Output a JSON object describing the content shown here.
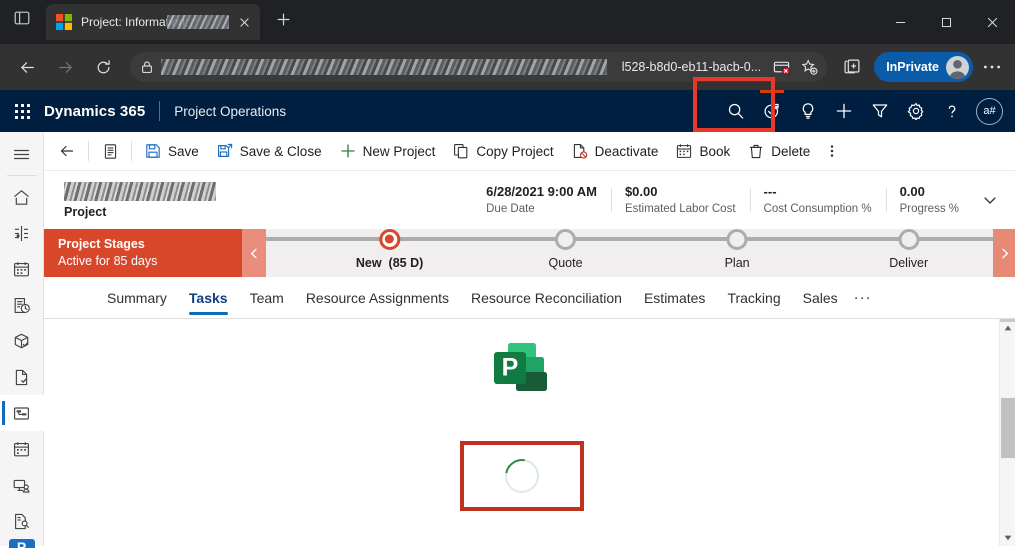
{
  "browser": {
    "tab": {
      "title_prefix": "Project: Information: ",
      "title_suffix": "e b",
      "favicon": "microsoft-logo-icon",
      "close_icon": "close-icon"
    },
    "new_tab_label": "+",
    "window_controls": {
      "minimize": "minimize-icon",
      "maximize": "maximize-icon",
      "close": "close-icon"
    },
    "nav": {
      "back": "back-arrow-icon",
      "forward": "forward-arrow-icon",
      "refresh": "refresh-icon"
    },
    "address_bar": {
      "lock_icon": "lock-icon",
      "url_visible": "l528-b8d0-eb11-bacb-0...",
      "popup_blocked_icon": "popup-blocked-icon",
      "favorite_icon": "add-favorite-star-icon"
    },
    "collections_icon": "collections-icon",
    "profile": {
      "label": "InPrivate",
      "avatar_icon": "person-avatar-icon"
    },
    "settings_icon": "more-settings-icon",
    "annotation_color": "#e8382a"
  },
  "d365_header": {
    "waffle_icon": "app-launcher-waffle-icon",
    "brand": "Dynamics 365",
    "app_name": "Project Operations",
    "icons": [
      {
        "name": "search-icon",
        "highlighted": false
      },
      {
        "name": "trial-status-icon",
        "highlighted": true
      },
      {
        "name": "lightbulb-idea-icon",
        "highlighted": false
      },
      {
        "name": "quick-create-plus-icon",
        "highlighted": false
      },
      {
        "name": "filter-funnel-icon",
        "highlighted": false
      },
      {
        "name": "settings-gear-icon",
        "highlighted": false
      },
      {
        "name": "help-question-icon",
        "highlighted": false
      }
    ],
    "user_initials": "a#"
  },
  "sitemap": {
    "items": [
      {
        "name": "site-map-hamburger",
        "icon": "hamburger-menu-icon",
        "active": false
      },
      {
        "name": "sidebar-item-home",
        "icon": "home-icon",
        "active": false
      },
      {
        "name": "sidebar-item-recent",
        "icon": "recent-clock-icon",
        "active": false
      },
      {
        "name": "sidebar-item-schedule",
        "icon": "calendar-icon",
        "active": false
      },
      {
        "name": "sidebar-item-time-entries",
        "icon": "time-entry-icon",
        "active": false
      },
      {
        "name": "sidebar-item-expenses",
        "icon": "package-box-icon",
        "active": false
      },
      {
        "name": "sidebar-item-approvals",
        "icon": "document-check-icon",
        "active": false
      },
      {
        "name": "sidebar-item-projects",
        "icon": "projects-board-icon",
        "active": true
      },
      {
        "name": "sidebar-item-bookings",
        "icon": "calendar-board-icon",
        "active": false
      },
      {
        "name": "sidebar-item-resource-requests",
        "icon": "resource-request-icon",
        "active": false
      },
      {
        "name": "sidebar-item-resources",
        "icon": "resource-person-icon",
        "active": false
      }
    ],
    "app_badge": "P"
  },
  "command_bar": {
    "back_icon": "back-arrow-icon",
    "form_selector_icon": "form-list-icon",
    "buttons": [
      {
        "label": "Save",
        "icon": "save-disk-icon"
      },
      {
        "label": "Save & Close",
        "icon": "save-close-icon"
      },
      {
        "label": "New Project",
        "icon": "plus-icon"
      },
      {
        "label": "Copy Project",
        "icon": "copy-icon"
      },
      {
        "label": "Deactivate",
        "icon": "deactivate-icon"
      },
      {
        "label": "Book",
        "icon": "calendar-book-icon"
      },
      {
        "label": "Delete",
        "icon": "trash-delete-icon"
      }
    ],
    "overflow_icon": "command-overflow-icon"
  },
  "record_header": {
    "entity_label": "Project",
    "title_redacted": true,
    "metrics": [
      {
        "value": "6/28/2021 9:00 AM",
        "label": "Due Date"
      },
      {
        "value": "$0.00",
        "label": "Estimated Labor Cost"
      },
      {
        "value": "---",
        "label": "Cost Consumption %"
      },
      {
        "value": "0.00",
        "label": "Progress %"
      }
    ],
    "expand_icon": "chevron-down-icon"
  },
  "process_flow": {
    "title": "Project Stages",
    "subtitle": "Active for 85 days",
    "prev_icon": "chevron-left-icon",
    "next_icon": "chevron-right-icon",
    "stages": [
      {
        "name": "New",
        "duration": "(85 D)",
        "current": true
      },
      {
        "name": "Quote",
        "duration": "",
        "current": false
      },
      {
        "name": "Plan",
        "duration": "",
        "current": false
      },
      {
        "name": "Deliver",
        "duration": "",
        "current": false
      }
    ],
    "active_color": "#d9472b"
  },
  "form_tabs": {
    "items": [
      {
        "label": "Summary",
        "active": false
      },
      {
        "label": "Tasks",
        "active": true
      },
      {
        "label": "Team",
        "active": false
      },
      {
        "label": "Resource Assignments",
        "active": false
      },
      {
        "label": "Resource Reconciliation",
        "active": false
      },
      {
        "label": "Estimates",
        "active": false
      },
      {
        "label": "Tracking",
        "active": false
      },
      {
        "label": "Sales",
        "active": false
      }
    ],
    "overflow_label": "···",
    "active_color": "#0f6cbd"
  },
  "content": {
    "logo_icon": "microsoft-project-logo-icon",
    "spinner_icon": "loading-spinner-icon",
    "highlight_color": "#c1311f"
  },
  "scrollbar": {
    "up_icon": "scroll-up-arrow-icon",
    "down_icon": "scroll-down-arrow-icon",
    "thumb": "scroll-thumb"
  }
}
